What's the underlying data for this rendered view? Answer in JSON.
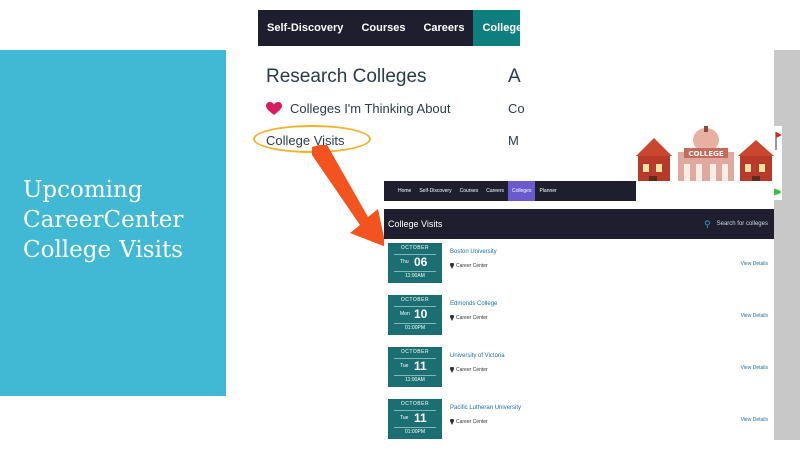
{
  "left": {
    "title_lines": [
      [
        "Upcoming"
      ],
      [
        "Career",
        "Center"
      ],
      [
        "College",
        "Visits"
      ]
    ]
  },
  "top_screenshot": {
    "nav": [
      "Self-Discovery",
      "Courses",
      "Careers",
      "Colleges"
    ],
    "active_nav": "Colleges",
    "research_title": "Research Colleges",
    "thinking_link": "Colleges I'm Thinking About",
    "visits_link": "College Visits",
    "cut_column": {
      "heading": "A",
      "row1": "Co",
      "row2": "M"
    },
    "heart_color": "#d81b60",
    "highlight_color": "#f0b429"
  },
  "bottom_screenshot": {
    "nav": [
      "Home",
      "Self-Discovery",
      "Courses",
      "Careers",
      "Colleges",
      "Planner"
    ],
    "active_nav": "Colleges",
    "header_title": "College Visits",
    "search_label": "Search for colleges",
    "visits": [
      {
        "month": "OCTOBER",
        "dow": "Thu",
        "day": "06",
        "time": "11:00AM",
        "name": "Boston University",
        "location": "Career Center",
        "link": "View Details"
      },
      {
        "month": "OCTOBER",
        "dow": "Mon",
        "day": "10",
        "time": "01:00PM",
        "name": "Edmonds College",
        "location": "Career Center",
        "link": "View Details"
      },
      {
        "month": "OCTOBER",
        "dow": "Tue",
        "day": "11",
        "time": "11:00AM",
        "name": "University of Victoria",
        "location": "Career Center",
        "link": "View Details"
      },
      {
        "month": "OCTOBER",
        "dow": "Tue",
        "day": "11",
        "time": "01:00PM",
        "name": "Pacific Lutheran University",
        "location": "Career Center",
        "link": "View Details"
      }
    ]
  },
  "clipart": {
    "sign_text": "COLLEGE"
  },
  "colors": {
    "panel": "#41b9d4",
    "teal_tile": "#1b6e72",
    "arrow": "#f2531f",
    "nav_bg": "#1e1e2e"
  }
}
